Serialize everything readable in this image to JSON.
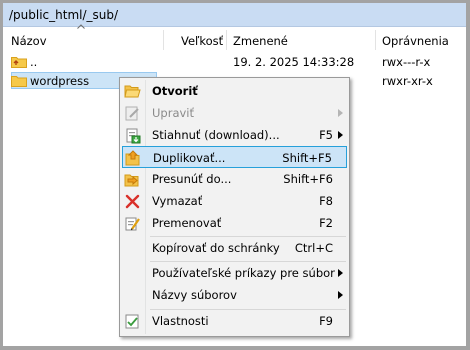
{
  "path": "/public_html/_sub/",
  "columns": {
    "name": "Názov",
    "size": "Veľkosť",
    "modified": "Zmenené",
    "permissions": "Oprávnenia"
  },
  "rows": [
    {
      "name": "..",
      "size": "",
      "modified": "19. 2. 2025 14:33:28",
      "permissions": "rwx---r-x",
      "type": "parent"
    },
    {
      "name": "wordpress",
      "size": "",
      "modified": "",
      "permissions": "rwxr-xr-x",
      "type": "folder",
      "selected": true
    }
  ],
  "context_menu": {
    "items": [
      {
        "label": "Otvoriť",
        "shortcut": "",
        "icon": "folder-open-icon",
        "bold": true
      },
      {
        "label": "Upraviť",
        "shortcut": "",
        "icon": "edit-icon",
        "disabled": true,
        "submenu": true
      },
      {
        "label": "Stiahnuť (download)...",
        "shortcut": "F5",
        "icon": "download-icon",
        "submenu": true
      },
      {
        "label": "Duplikovať...",
        "shortcut": "Shift+F5",
        "icon": "duplicate-icon",
        "highlighted": true
      },
      {
        "label": "Presunúť do...",
        "shortcut": "Shift+F6",
        "icon": "move-icon"
      },
      {
        "label": "Vymazať",
        "shortcut": "F8",
        "icon": "delete-icon"
      },
      {
        "label": "Premenovať",
        "shortcut": "F2",
        "icon": "rename-icon"
      },
      {
        "label": "Kopírovať do schránky",
        "shortcut": "Ctrl+C",
        "icon": ""
      },
      {
        "label": "Používateľské príkazy pre súbor",
        "shortcut": "",
        "icon": "",
        "submenu": true
      },
      {
        "label": "Názvy súborov",
        "shortcut": "",
        "icon": "",
        "submenu": true
      },
      {
        "label": "Vlastnosti",
        "shortcut": "F9",
        "icon": "properties-icon"
      }
    ]
  },
  "colors": {
    "pathbar": "#c9dcf3",
    "selection": "#cce4f7",
    "highlight_border": "#26a0da",
    "menu_bg": "#f2f2f2"
  }
}
